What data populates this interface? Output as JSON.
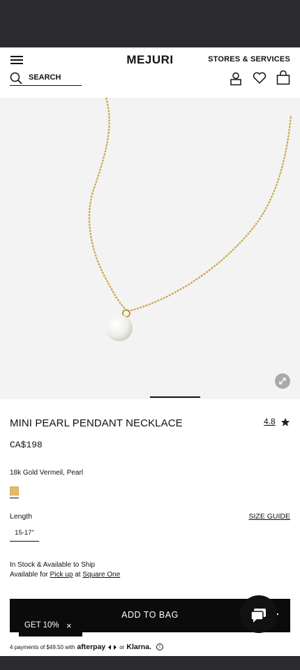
{
  "header": {
    "logo": "MEJURI",
    "stores_label": "STORES & SERVICES",
    "search_label": "SEARCH"
  },
  "product": {
    "title": "MINI PEARL PENDANT NECKLACE",
    "rating": "4.8",
    "price": "CA$198",
    "material": "18k Gold Vermeil, Pearl",
    "swatch_color": "#e3b96a",
    "length_label": "Length",
    "size_guide_label": "SIZE GUIDE",
    "length_option": "15-17\"",
    "stock_line1": "In Stock & Available to Ship",
    "stock_prefix": "Available for",
    "stock_pickup": "Pick up",
    "stock_at": "at",
    "stock_location": "Square One",
    "add_to_bag": "ADD TO BAG"
  },
  "promo": {
    "label": "GET 10%",
    "close": "×"
  },
  "payment": {
    "prefix": "4 payments of $49.50 with",
    "afterpay": "afterpay",
    "or": "or",
    "klarna": "Klarna."
  },
  "colors": {
    "gold": "#c9a646",
    "dark": "#0b0b0b"
  }
}
